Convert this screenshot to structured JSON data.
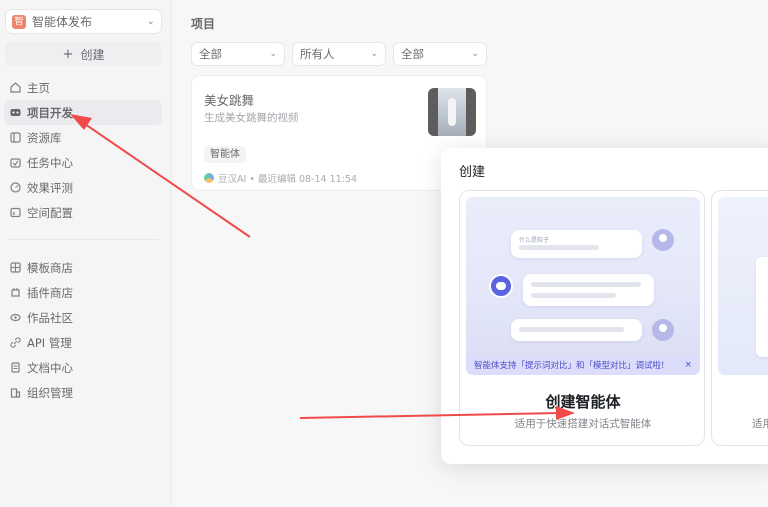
{
  "workspace": {
    "name": "智能体发布",
    "logo_text": "智"
  },
  "sidebar": {
    "create_label": "创建",
    "nav": [
      {
        "label": "主页",
        "icon": "home-icon"
      },
      {
        "label": "项目开发",
        "icon": "project-icon",
        "active": true
      },
      {
        "label": "资源库",
        "icon": "library-icon"
      },
      {
        "label": "任务中心",
        "icon": "task-icon"
      },
      {
        "label": "效果评测",
        "icon": "evaluation-icon"
      },
      {
        "label": "空间配置",
        "icon": "space-config-icon"
      }
    ],
    "nav2": [
      {
        "label": "模板商店",
        "icon": "template-icon"
      },
      {
        "label": "插件商店",
        "icon": "plugin-icon"
      },
      {
        "label": "作品社区",
        "icon": "community-icon"
      },
      {
        "label": "API 管理",
        "icon": "api-icon"
      },
      {
        "label": "文档中心",
        "icon": "docs-icon"
      },
      {
        "label": "组织管理",
        "icon": "org-icon"
      }
    ]
  },
  "main": {
    "title": "项目",
    "filters": [
      "全部",
      "所有人",
      "全部"
    ],
    "card": {
      "title": "美女跳舞",
      "desc": "生成美女跳舞的视频",
      "tag": "智能体",
      "meta": "豆汉AI • 最近编辑 08-14 11:54"
    }
  },
  "modal": {
    "title": "创建",
    "option_a": {
      "question_text": "什么是粒子",
      "banner": "智能体支持「提示词对比」和「模型对比」调试啦!",
      "banner_close": "×",
      "name": "创建智能体",
      "desc": "适用于快速搭建对话式智能体"
    },
    "option_b": {
      "desc": "适用"
    }
  },
  "colors": {
    "accent": "#4b4fc9",
    "arrow": "#f04a4a",
    "brand": "#e34f2a"
  }
}
